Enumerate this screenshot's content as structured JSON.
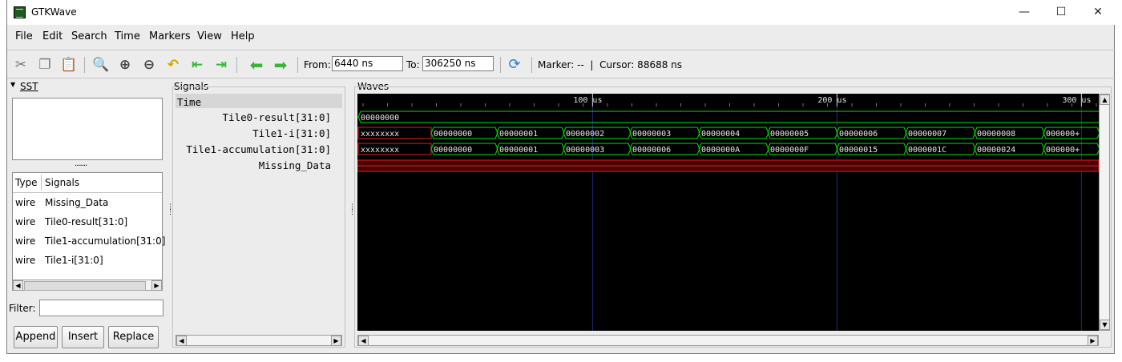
{
  "window": {
    "title": "GTKWave",
    "controls": {
      "minimize": "—",
      "maximize": "☐",
      "close": "✕"
    }
  },
  "menu": [
    "File",
    "Edit",
    "Search",
    "Time",
    "Markers",
    "View",
    "Help"
  ],
  "toolbar": {
    "from_label": "From:",
    "from_value": "6440 ns",
    "to_label": "To:",
    "to_value": "306250 ns",
    "marker_text": "Marker: --  |  Cursor: 88688 ns"
  },
  "sst": {
    "label": "SST",
    "grip": "......."
  },
  "sst_table": {
    "col_type": "Type",
    "col_signals": "Signals",
    "rows": [
      {
        "type": "wire",
        "name": "Missing_Data"
      },
      {
        "type": "wire",
        "name": "Tile0-result[31:0]"
      },
      {
        "type": "wire",
        "name": "Tile1-accumulation[31:0]"
      },
      {
        "type": "wire",
        "name": "Tile1-i[31:0]"
      }
    ]
  },
  "filter": {
    "label": "Filter:",
    "value": ""
  },
  "buttons": {
    "append": "Append",
    "insert": "Insert",
    "replace": "Replace"
  },
  "signals_panel": {
    "label": "Signals",
    "header": "Time",
    "rows": [
      "Tile0-result[31:0]",
      "Tile1-i[31:0]",
      "Tile1-accumulation[31:0]",
      "Missing_Data"
    ]
  },
  "waves": {
    "label": "Waves",
    "time_start_ns": 6440,
    "time_end_ns": 306250,
    "cursor_ns": 88688,
    "ticks": [
      {
        "t": 100000,
        "label": "100 us"
      },
      {
        "t": 200000,
        "label": "200 us"
      },
      {
        "t": 300000,
        "label": "300 us"
      }
    ],
    "tile0_result": "00000000",
    "tile1_i": {
      "first": "xxxxxxxx",
      "values": [
        "00000000",
        "00000001",
        "00000002",
        "00000003",
        "00000004",
        "00000005",
        "00000006",
        "00000007",
        "00000008",
        "000000+"
      ]
    },
    "tile1_accumulation": {
      "first": "xxxxxxxx",
      "values": [
        "00000000",
        "00000001",
        "00000003",
        "00000006",
        "0000000A",
        "0000000F",
        "00000015",
        "0000001C",
        "00000024",
        "000000+"
      ]
    }
  }
}
